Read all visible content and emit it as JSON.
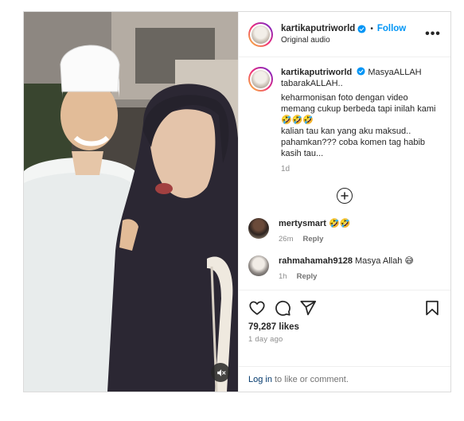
{
  "post": {
    "author": "kartikaputriworld",
    "follow_label": "Follow",
    "separator": "•",
    "audio_label": "Original audio",
    "more_label": "•••"
  },
  "caption": {
    "username": "kartikaputriworld",
    "lines": [
      "MasyaALLAH tabarakALLAH..",
      "keharmonisan foto dengan video memang cukup berbeda tapi inilah kami🤣🤣🤣",
      "kalian tau kan yang aku maksud.. pahamkan??? coba komen tag habib kasih tau..."
    ],
    "time": "1d"
  },
  "comments": [
    {
      "username": "mertysmart",
      "text": "🤣🤣",
      "time": "26m",
      "reply_label": "Reply"
    },
    {
      "username": "rahmahamah9128",
      "text": "Masya Allah 😅",
      "time": "1h",
      "reply_label": "Reply"
    }
  ],
  "stats": {
    "likes": "79,287 likes",
    "ago": "1 day ago"
  },
  "login": {
    "link_label": "Log in",
    "suffix": "to like or comment."
  },
  "icons": {
    "verified": "verified-badge-icon",
    "more": "more-options-icon",
    "add": "plus-circle-icon",
    "like": "heart-icon",
    "comment": "comment-bubble-icon",
    "share": "send-icon",
    "save": "bookmark-icon",
    "mute": "speaker-muted-icon"
  },
  "colors": {
    "accent": "#0095f6",
    "verified": "#0095f6",
    "text": "#262626",
    "muted": "#8e8e8e",
    "link": "#00376b"
  }
}
